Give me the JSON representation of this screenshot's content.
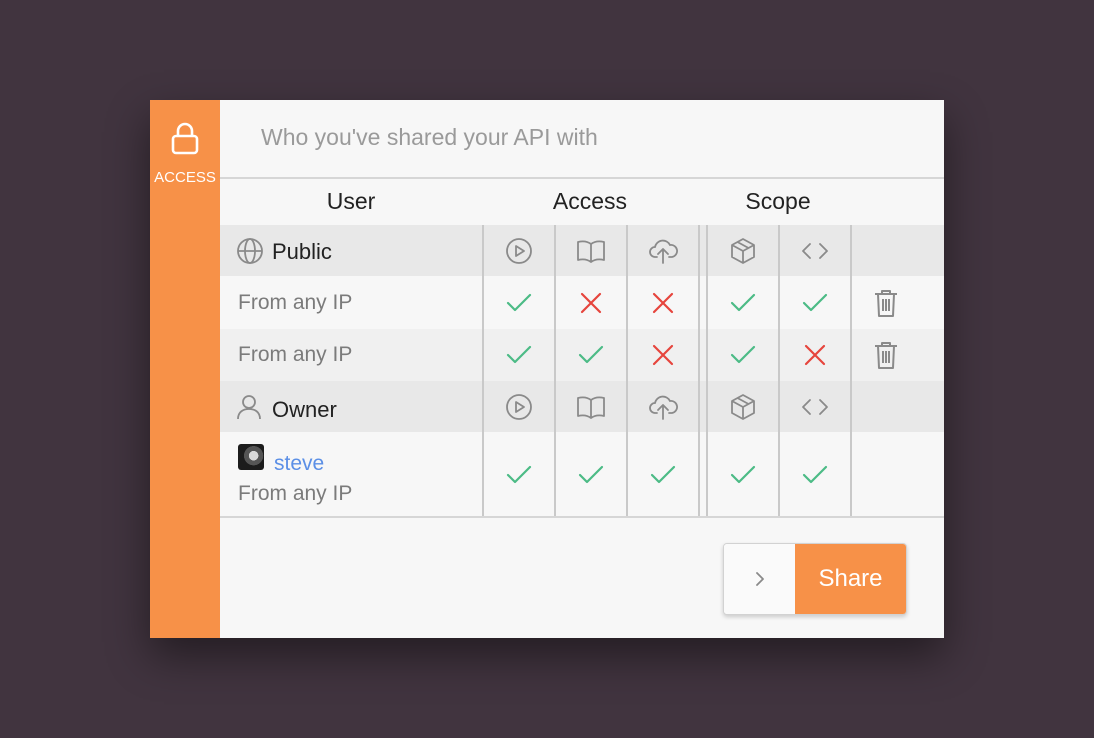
{
  "sidebar": {
    "label": "ACCESS",
    "icon": "lock-icon"
  },
  "subtitle": "Who you've shared your API with",
  "columns": {
    "user": "User",
    "access": "Access",
    "scope": "Scope"
  },
  "groups": [
    {
      "name": "Public",
      "icon": "globe-icon",
      "header_icons": [
        "play-circle-icon",
        "book-open-icon",
        "cloud-upload-icon",
        "box-icon",
        "code-icon"
      ],
      "rows": [
        {
          "label": "From any IP",
          "perms": [
            true,
            false,
            false,
            true,
            true
          ],
          "deletable": true
        },
        {
          "label": "From any IP",
          "perms": [
            true,
            true,
            false,
            true,
            false
          ],
          "deletable": true
        }
      ]
    },
    {
      "name": "Owner",
      "icon": "user-icon",
      "header_icons": [
        "play-circle-icon",
        "book-open-icon",
        "cloud-upload-icon",
        "box-icon",
        "code-icon"
      ],
      "rows": [
        {
          "user": "steve",
          "label": "From any IP",
          "perms": [
            true,
            true,
            true,
            true,
            true
          ],
          "deletable": false
        }
      ]
    }
  ],
  "actions": {
    "share_label": "Share",
    "more_icon": "chevron-right-icon"
  },
  "colors": {
    "accent": "#f79148",
    "check": "#4cbb86",
    "cross": "#e6453d",
    "link": "#5b8fe6",
    "background": "#41343f"
  }
}
